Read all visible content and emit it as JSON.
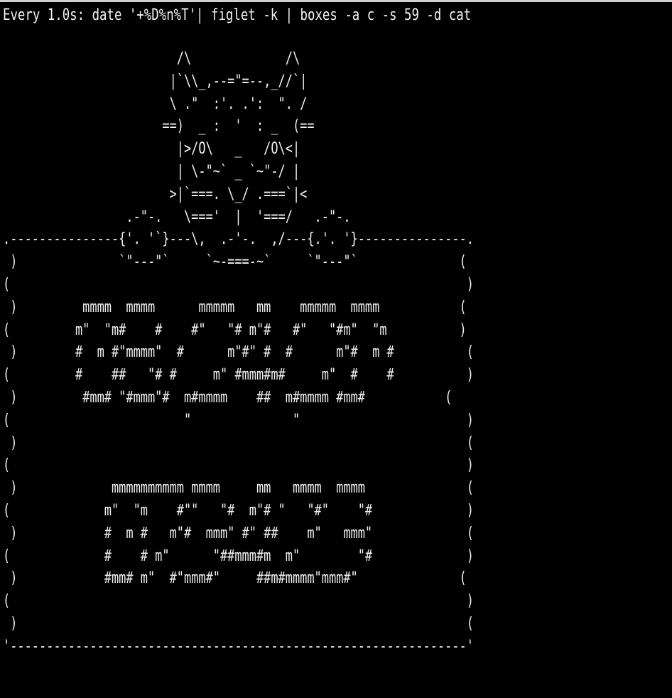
{
  "terminal": {
    "command_line": "Every 1.0s: date '+%D%n%T'| figlet -k | boxes -a c -s 59 -d cat",
    "output_lines": [
      "                        /\\             /\\",
      "                       |`\\\\_,--=\"=--,_//`|",
      "                       \\ .\"  :'. .':  \". /",
      "                      ==)  _ :  '  : _  (==",
      "                        |>/O\\   _   /O\\<|",
      "                        | \\-\"~` _ `~\"-/ |",
      "                       >|`===. \\_/ .===`|<",
      "                 .-\"-.   \\==='  |  '===/   .-\"-.",
      ".---------------{'. '`}---\\,  .-'-.  ,/---{.'. '}---------------.",
      " )              `\"---\"`     `~-===-~`     `\"---\"`              (",
      "(                                                               )",
      " )         mmmm  mmmm      mmmmm   mm    mmmmm  mmmm           (",
      "(         m\"  \"m#    #    #\"   \"# m\"#   #\"   \"#m\"  \"m          )",
      " )        #  m #\"mmmm\"  #      m\"#\" #  #      m\"#  m #          (",
      "(         #    ##   \"# #     m\" #mmm#m#     m\"  #    #          )",
      " )         #mm# \"#mmm\"#  m#mmmm    ##  m#mmmm #mm#           (",
      "(                        \"              \"                       )",
      " )                                                              (",
      "(                                                               )",
      " )             mmmmmmmmmm mmmm     mm   mmmm  mmmm              (",
      "(             m\"  \"m    #\"\"   \"#  m\"# \"   \"#\"    \"#             )",
      " )            #  m #   m\"#  mmm\" #\" ##    m\"   mmm\"             (",
      "(             #    # m\"      \"##mmm#m  m\"        \"#             )",
      " )            #mm# m\"  #\"mmm#\"     ##m#mmmm\"mmm#\"              (",
      "(                                                               )",
      " )                                                              (",
      "'---------------------------------------------------------------'"
    ]
  },
  "colors": {
    "background": "#000000",
    "foreground": "#f2f2f2"
  }
}
